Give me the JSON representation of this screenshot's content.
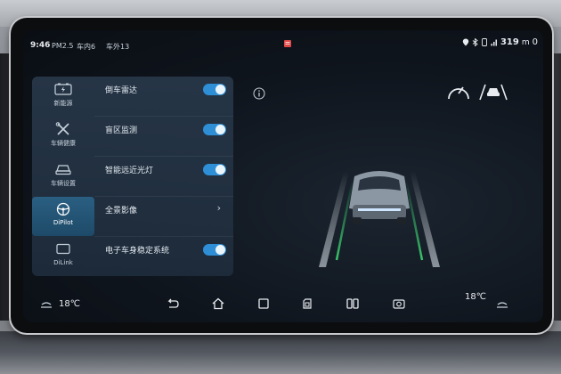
{
  "status": {
    "time": "9:46",
    "pm": "PM2.5",
    "in_car": "车内6",
    "outside": "车外13",
    "range": "319",
    "range_unit": "m",
    "temp": "0"
  },
  "nav": [
    {
      "label": "新能源",
      "icon": "battery-icon"
    },
    {
      "label": "车辆健康",
      "icon": "tools-icon"
    },
    {
      "label": "车辆设置",
      "icon": "car-icon"
    },
    {
      "label": "DiPilot",
      "icon": "steering-wheel-icon",
      "active": true
    },
    {
      "label": "DiLink",
      "icon": "screen-icon"
    }
  ],
  "settings": [
    {
      "label": "倒车雷达",
      "control": "toggle",
      "on": true
    },
    {
      "label": "盲区监测",
      "control": "toggle",
      "on": true
    },
    {
      "label": "智能远近光灯",
      "control": "toggle",
      "on": true
    },
    {
      "label": "全景影像",
      "control": "chevron"
    },
    {
      "label": "电子车身稳定系统",
      "control": "toggle",
      "on": true
    }
  ],
  "bottom": {
    "temp_left": "18℃",
    "temp_right": "18℃"
  },
  "colors": {
    "accent": "#2f8fd6",
    "lane_green": "#39c46a"
  }
}
